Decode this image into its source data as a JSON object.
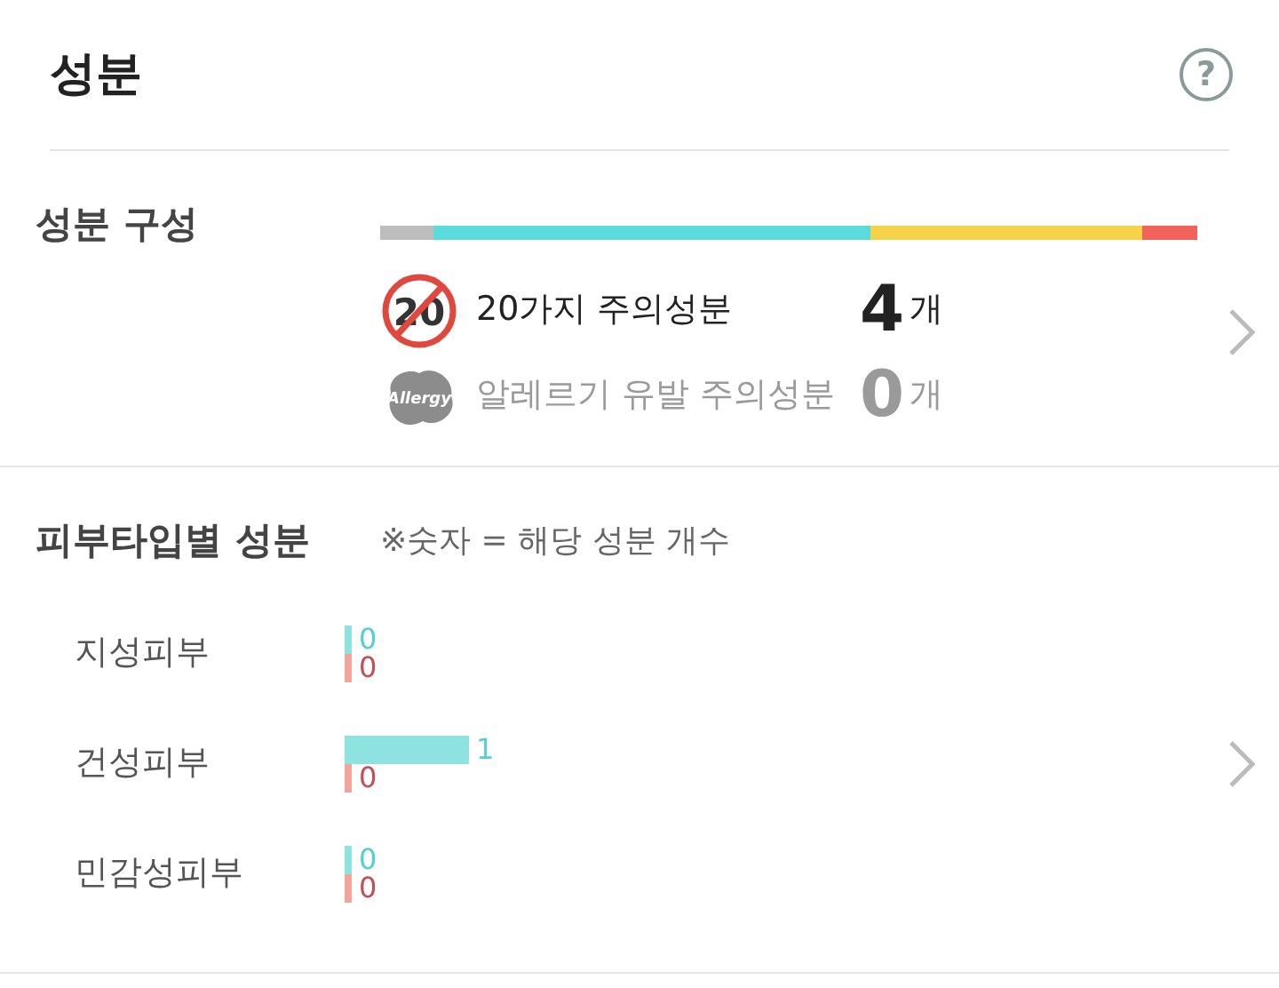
{
  "header": {
    "title": "성분",
    "help_icon": "?"
  },
  "composition": {
    "label": "성분 구성",
    "segments": [
      {
        "color": "#bdbdbd"
      },
      {
        "color": "#5adcdc"
      },
      {
        "color": "#f5d24a"
      },
      {
        "color": "#f0625a"
      }
    ],
    "rows": [
      {
        "kind": "twenty",
        "icon_text": "20",
        "label": "20가지 주의성분",
        "count": "4",
        "unit": "개",
        "dimmed": false
      },
      {
        "kind": "allergy",
        "icon_text": "Allergy",
        "label": "알레르기 유발 주의성분",
        "count": "0",
        "unit": "개",
        "dimmed": true
      }
    ]
  },
  "skin_types": {
    "label": "피부타입별 성분",
    "note": "※숫자 = 해당 성분 개수",
    "rows": [
      {
        "name": "지성피부",
        "good": {
          "count": "0"
        },
        "bad": {
          "count": "0"
        }
      },
      {
        "name": "건성피부",
        "good": {
          "count": "1"
        },
        "bad": {
          "count": "0"
        }
      },
      {
        "name": "민감성피부",
        "good": {
          "count": "0"
        },
        "bad": {
          "count": "0"
        }
      }
    ]
  }
}
